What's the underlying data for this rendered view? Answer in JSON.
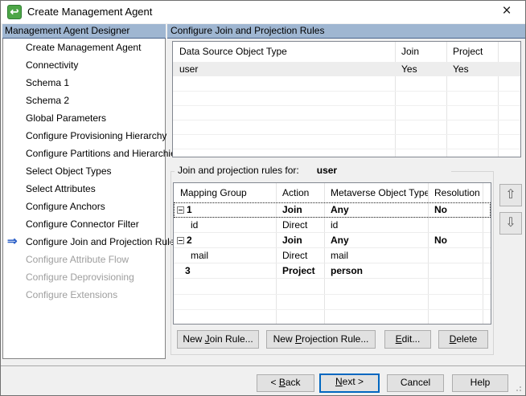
{
  "window": {
    "title": "Create Management Agent"
  },
  "icons": {
    "title_arrow": "↩",
    "close": "×",
    "active_arrow": "⇒",
    "up_arrow": "⇧",
    "down_arrow": "⇩"
  },
  "colors": {
    "header_bar": "#9FB6D1",
    "focus_accent": "#0067C0",
    "active_arrow_blue": "#2B5FC7"
  },
  "sidebar": {
    "header": "Management Agent Designer",
    "items": [
      {
        "label": "Create Management Agent",
        "state": "normal"
      },
      {
        "label": "Connectivity",
        "state": "normal"
      },
      {
        "label": "Schema 1",
        "state": "normal"
      },
      {
        "label": "Schema 2",
        "state": "normal"
      },
      {
        "label": "Global Parameters",
        "state": "normal"
      },
      {
        "label": "Configure Provisioning Hierarchy",
        "state": "normal"
      },
      {
        "label": "Configure Partitions and Hierarchies",
        "state": "normal"
      },
      {
        "label": "Select Object Types",
        "state": "normal"
      },
      {
        "label": "Select Attributes",
        "state": "normal"
      },
      {
        "label": "Configure Anchors",
        "state": "normal"
      },
      {
        "label": "Configure Connector Filter",
        "state": "normal"
      },
      {
        "label": "Configure Join and Projection Rules",
        "state": "active"
      },
      {
        "label": "Configure Attribute Flow",
        "state": "disabled"
      },
      {
        "label": "Configure Deprovisioning",
        "state": "disabled"
      },
      {
        "label": "Configure Extensions",
        "state": "disabled"
      }
    ]
  },
  "panel": {
    "header": "Configure Join and Projection Rules",
    "object_table": {
      "columns": [
        "Data Source Object Type",
        "Join",
        "Project"
      ],
      "row": {
        "type": "user",
        "join": "Yes",
        "project": "Yes"
      }
    },
    "rules": {
      "label": "Join and projection rules for:",
      "object": "user",
      "columns": [
        "Mapping Group",
        "Action",
        "Metaverse Object Type",
        "Resolution"
      ],
      "rows": [
        {
          "group": "1",
          "action": "Join",
          "metaverse": "Any",
          "resolution": "No"
        },
        {
          "group": "id",
          "action": "Direct",
          "metaverse": "id",
          "resolution": ""
        },
        {
          "group": "2",
          "action": "Join",
          "metaverse": "Any",
          "resolution": "No"
        },
        {
          "group": "mail",
          "action": "Direct",
          "metaverse": "mail",
          "resolution": ""
        },
        {
          "group": "3",
          "action": "Project",
          "metaverse": "person",
          "resolution": ""
        }
      ]
    },
    "actions": {
      "new_join": {
        "pre": "New ",
        "key": "J",
        "post": "oin Rule..."
      },
      "new_projection": {
        "pre": "New ",
        "key": "P",
        "post": "rojection Rule..."
      },
      "edit": {
        "pre": "",
        "key": "E",
        "post": "dit..."
      },
      "delete": {
        "pre": "",
        "key": "D",
        "post": "elete"
      }
    }
  },
  "footer": {
    "back": {
      "pre": "< ",
      "key": "B",
      "post": "ack"
    },
    "next": {
      "pre": "",
      "key": "N",
      "post": "ext >"
    },
    "cancel": "Cancel",
    "help": "Help"
  }
}
